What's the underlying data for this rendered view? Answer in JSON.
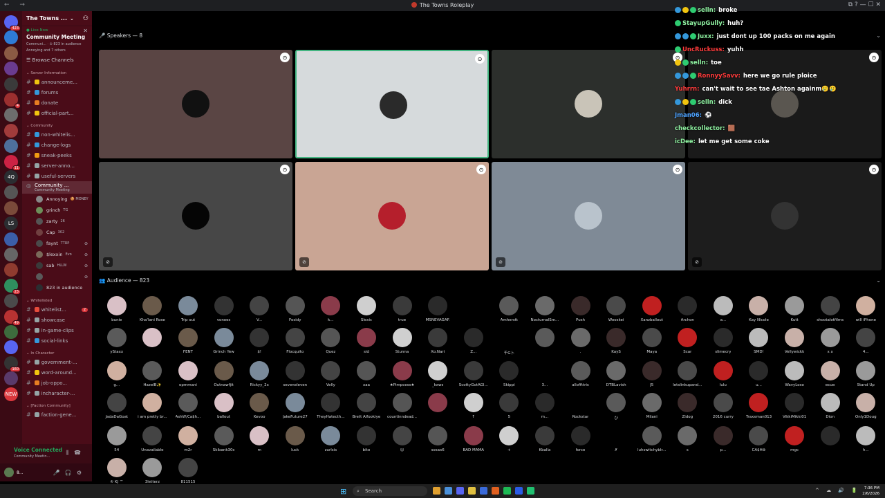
{
  "window": {
    "title": "The Towns Roleplay",
    "nav_arrows": "← →",
    "controls": "⧉ ? — ☐ ✕"
  },
  "rail": {
    "servers": [
      {
        "label": "",
        "color": "#5865f2",
        "badge": "423"
      },
      {
        "label": "",
        "color": "#2e7bd6",
        "badge": ""
      },
      {
        "label": "",
        "color": "#8a5a44",
        "badge": ""
      },
      {
        "label": "",
        "color": "#6a3b8f",
        "badge": ""
      },
      {
        "label": "",
        "color": "#3a3a3a",
        "badge": ""
      },
      {
        "label": "",
        "color": "#9c2f2f",
        "badge": "4"
      },
      {
        "label": "",
        "color": "#6d6d6d",
        "badge": ""
      },
      {
        "label": "",
        "color": "#a13b3b",
        "badge": ""
      },
      {
        "label": "",
        "color": "#4e6f9c",
        "badge": ""
      },
      {
        "label": "",
        "color": "#cc2244",
        "badge": "11"
      },
      {
        "label": "4Q",
        "color": "#2b2d31",
        "badge": ""
      },
      {
        "label": "",
        "color": "#555555",
        "badge": ""
      },
      {
        "label": "",
        "color": "#7a4a3a",
        "badge": ""
      },
      {
        "label": "LS",
        "color": "#2b2d31",
        "badge": ""
      },
      {
        "label": "",
        "color": "#3b5ea8",
        "badge": ""
      },
      {
        "label": "",
        "color": "#666666",
        "badge": ""
      },
      {
        "label": "",
        "color": "#8f3b2f",
        "badge": ""
      },
      {
        "label": "",
        "color": "#2f8f5f",
        "badge": "23"
      },
      {
        "label": "",
        "color": "#4a4a4a",
        "badge": ""
      },
      {
        "label": "",
        "color": "#b83232",
        "badge": "49"
      },
      {
        "label": "",
        "color": "#3d6b3d",
        "badge": ""
      },
      {
        "label": "",
        "color": "#5865f2",
        "badge": ""
      },
      {
        "label": "",
        "color": "#333333",
        "badge": "160"
      },
      {
        "label": "",
        "color": "#5a3a6a",
        "badge": ""
      },
      {
        "label": "NEW",
        "color": "#da373c",
        "badge": ""
      }
    ]
  },
  "sidebar": {
    "server_name": "The Towns ...",
    "live": {
      "label": "● Live Now",
      "event_name": "Community Meeting",
      "meta": "Communi... · ⊙ 823 in audience",
      "others": "Annoying and 7 others"
    },
    "browse": "Browse Channels",
    "categories": [
      {
        "name": "Server Information",
        "channels": [
          {
            "name": "announceme...",
            "emoji_color": "#f1c40f"
          },
          {
            "name": "forums",
            "emoji_color": "#3498db"
          },
          {
            "name": "donate",
            "emoji_color": "#e67e22"
          },
          {
            "name": "official-part...",
            "emoji_color": "#f1c40f"
          }
        ]
      },
      {
        "name": "Community",
        "channels": [
          {
            "name": "non-whitelis...",
            "emoji_color": "#3498db"
          },
          {
            "name": "change-logs",
            "emoji_color": "#3498db"
          },
          {
            "name": "sneak-peeks",
            "emoji_color": "#f39c12"
          },
          {
            "name": "server-anno...",
            "emoji_color": "#95a5a6"
          },
          {
            "name": "useful-servers",
            "emoji_color": "#95a5a6"
          }
        ]
      }
    ],
    "active_stage": {
      "name": "Community ...",
      "sub": "Community Meeting"
    },
    "stage_members": [
      {
        "name": "Annoying",
        "tag": "🍪 MONEY",
        "mic": "",
        "color": "#888888"
      },
      {
        "name": "grinch",
        "tag": "TG",
        "mic": "",
        "color": "#6d8f5a"
      },
      {
        "name": "zarty",
        "tag": "26",
        "mic": "",
        "color": "#555555"
      },
      {
        "name": "Cap",
        "tag": "302",
        "mic": "",
        "color": "#704040"
      },
      {
        "name": "faynt",
        "tag": "TTRP",
        "mic": "⊘",
        "color": "#4a4a4a"
      },
      {
        "name": "$lexxin",
        "tag": "Evo",
        "mic": "⊘",
        "color": "#7a6a5a"
      },
      {
        "name": "sab",
        "tag": "HLLW",
        "mic": "⊘",
        "color": "#3a3a3a"
      },
      {
        "name": "",
        "tag": "",
        "mic": "⊘",
        "color": "#5a5a5a"
      },
      {
        "name": "823 in audience",
        "tag": "",
        "mic": "",
        "color": "#2b2d31"
      }
    ],
    "categories2": [
      {
        "name": "Whitelisted",
        "channels": [
          {
            "name": "whitelist...",
            "emoji_color": "#e74c3c",
            "badge": "2"
          },
          {
            "name": "showcase",
            "emoji_color": "#95a5a6",
            "badge": ""
          },
          {
            "name": "in-game-clips",
            "emoji_color": "#95a5a6",
            "badge": ""
          },
          {
            "name": "social-links",
            "emoji_color": "#3498db",
            "badge": ""
          }
        ]
      },
      {
        "name": "In Character",
        "channels": [
          {
            "name": "government-...",
            "emoji_color": "#95a5a6",
            "badge": ""
          },
          {
            "name": "word-around...",
            "emoji_color": "#f1c40f",
            "badge": ""
          },
          {
            "name": "job-oppo...",
            "emoji_color": "#e67e22",
            "badge": ""
          },
          {
            "name": "incharacter-...",
            "emoji_color": "#95a5a6",
            "badge": ""
          }
        ]
      },
      {
        "name": "[Faction Community]",
        "channels": [
          {
            "name": "faction-gene...",
            "emoji_color": "#95a5a6",
            "badge": ""
          }
        ]
      }
    ],
    "voice": {
      "status": "Voice Connected",
      "channel": "Community Meetin..."
    },
    "user": {
      "name": "8..."
    }
  },
  "stage": {
    "speakers_label": "Speakers — 8",
    "audience_label": "Audience — 823",
    "collapse_icon": "⌄",
    "speakers": [
      {
        "bg": "#5a4544",
        "pfp": "#111111",
        "muted": false,
        "border": "none"
      },
      {
        "bg": "#d6dadc",
        "pfp": "#2a2a2a",
        "muted": false,
        "border": "#43b581"
      },
      {
        "bg": "#2c2f2c",
        "pfp": "#c9c4b8",
        "muted": false,
        "border": "none"
      },
      {
        "bg": "#1a1a1a",
        "pfp": "#5a5650",
        "muted": false,
        "border": "none"
      },
      {
        "bg": "#474747",
        "pfp": "#050505",
        "muted": true,
        "border": "none"
      },
      {
        "bg": "#c9a594",
        "pfp": "#b51f2c",
        "muted": true,
        "border": "none"
      },
      {
        "bg": "#7f8a96",
        "pfp": "#b9c3cc",
        "muted": true,
        "border": "none"
      },
      {
        "bg": "#1d1d1d",
        "pfp": "#333333",
        "muted": true,
        "border": "none"
      }
    ],
    "audience": [
      "bunie",
      "Kha'lani Rose",
      "Trip out",
      "vonoes",
      "V...",
      "Fosidy",
      "k...",
      "Slexic",
      "true",
      "MSNEVAGAF.",
      "",
      "Amherstt",
      "NocturnalSm...",
      "Push",
      "Wooskei",
      "Xanzballout",
      "Archon",
      "a...",
      "Kay Nicole",
      "Kutt",
      "shootalotfilms",
      "will iPhone",
      "yStaxx",
      "",
      "FENT",
      "Grinch Yew",
      "$!",
      "Flocquito",
      "Quez",
      "sid",
      "Stunna",
      "Xo.Nari",
      "Z...",
      "千G卜",
      "",
      ".",
      "KayS",
      "Maya",
      "Scar",
      "slimecry",
      "SMD!",
      "Vellywickk",
      "x x",
      "4...",
      "g...",
      "HazelB✨",
      "opmmani",
      "Outnawfjit",
      "Rickyy_2x",
      "seveneleven",
      "Velly",
      "xaa",
      "★Pimpcess★",
      "_kxws",
      "ScottyGotAGl...",
      "Skippi",
      "3...",
      "alloffttris",
      "DTBLavish",
      "J5",
      "letslinkupand...",
      "lulu",
      "u...",
      "WavyLoso",
      "ʚcuʚ",
      "Stand Up",
      "JadaDaGoat",
      "i am pretty br...",
      "AshW/Ca$h...",
      "ballout",
      "Kevoo",
      "JakeFuture27",
      "TheyHatecth...",
      "Brett Alfookiye",
      "countinndead...",
      "",
      "↑",
      "5",
      "m...",
      "Rockstar",
      "ひ",
      "Milani",
      "Zidog",
      "2016 curry",
      "Traxxman013",
      "VikkiMikki01",
      "Dion",
      "Only1Doug",
      "54",
      "Unavailable",
      "m2r",
      "Skibank30s",
      "m",
      "luck",
      "zurlsis",
      "bito",
      "☺",
      "sosax6",
      "BAD MAMA",
      "+",
      "Kballa",
      "force",
      "✗",
      "luhswitchyblr...",
      "s",
      "p...",
      "CA$H⊛",
      "mgc",
      "",
      "h...",
      "♔ KJ ™",
      "3letterz",
      "811515"
    ],
    "audience_colors": [
      "#d9c0c6",
      "#6a5a4a",
      "#7a8a9a",
      "#333333",
      "#444444",
      "#555555",
      "#8a3b4a",
      "#cfcfcf",
      "#3a3a3a",
      "#2a2a2a",
      "#000000",
      "#5a5a5a",
      "#6a6a6a",
      "#3a2a2a",
      "#4a4a4a",
      "#c02020",
      "#2a2a2a",
      "#bbbbbb",
      "#c8b0a8",
      "#9a9a9a",
      "#444444",
      "#d0b0a0",
      "#5a5a5a"
    ]
  },
  "chat": [
    {
      "user": "selln:",
      "text": "broke",
      "color": "#8ef0a0",
      "badges": [
        "#3498db",
        "#f1c40f",
        "#2ecc71"
      ]
    },
    {
      "user": "StayupGully:",
      "text": "huh?",
      "color": "#8ef0a0",
      "badges": [
        "#2ecc71"
      ]
    },
    {
      "user": "Juxx:",
      "text": "just dont up 100 packs on me again",
      "color": "#8ef0a0",
      "badges": [
        "#3498db",
        "#3498db",
        "#2ecc71"
      ]
    },
    {
      "user": "UncRuckuss:",
      "text": "yuhh",
      "color": "#ff3b3b",
      "badges": [
        "#2ecc71"
      ]
    },
    {
      "user": "selln:",
      "text": "toe",
      "color": "#8ef0a0",
      "badges": [
        "#f1c40f",
        "#2ecc71"
      ]
    },
    {
      "user": "RonnyySavv:",
      "text": "here we go rule ploice",
      "color": "#ff3b3b",
      "badges": [
        "#3498db",
        "#3498db",
        "#2ecc71"
      ]
    },
    {
      "user": "Yuhrrn:",
      "text": "can't wait to see tae Ashton againm🥲🥲",
      "color": "#ff3b3b",
      "badges": []
    },
    {
      "user": "selln:",
      "text": "dick",
      "color": "#8ef0a0",
      "badges": [
        "#3498db",
        "#f1c40f",
        "#2ecc71"
      ]
    },
    {
      "user": "Jman06:",
      "text": "⚽",
      "color": "#4da3ff",
      "badges": []
    },
    {
      "user": "checkcollector:",
      "text": "🟫",
      "color": "#8ef0a0",
      "badges": []
    },
    {
      "user": "icDee:",
      "text": "let me get some coke",
      "color": "#8ef0a0",
      "badges": []
    }
  ],
  "taskbar": {
    "search": "Search",
    "time": "7:36 PM",
    "date": "2/6/2026",
    "tray": "^ ☁ 🔊 🔋",
    "apps": [
      "#e0a030",
      "#4a90d9",
      "#5865f2",
      "#e0c040",
      "#3a6ad9",
      "#e06020",
      "#1db954",
      "#2b5ce6",
      "#20c070"
    ]
  }
}
